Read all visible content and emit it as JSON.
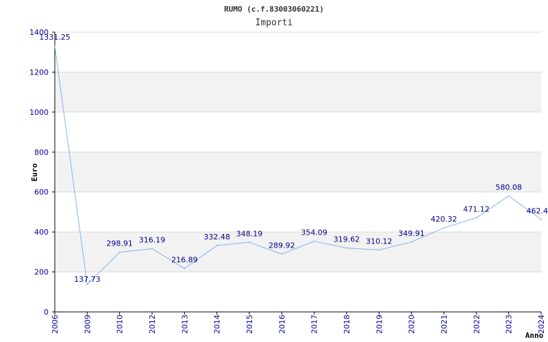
{
  "chart_data": {
    "type": "line",
    "title": "RUMO (c.f.83003060221)",
    "subtitle": "Importi",
    "xlabel": "Anno",
    "ylabel": "Euro",
    "categories": [
      "2006",
      "2009",
      "2010",
      "2012",
      "2013",
      "2014",
      "2015",
      "2016",
      "2017",
      "2018",
      "2019",
      "2020",
      "2021",
      "2022",
      "2023",
      "2024"
    ],
    "values": [
      1331.25,
      137.73,
      298.91,
      316.19,
      216.89,
      332.48,
      348.19,
      289.92,
      354.09,
      319.62,
      310.12,
      349.91,
      420.32,
      471.12,
      580.08,
      462.4
    ],
    "value_labels": [
      "1331.25",
      "137.73",
      "298.91",
      "316.19",
      "216.89",
      "332.48",
      "348.19",
      "289.92",
      "354.09",
      "319.62",
      "310.12",
      "349.91",
      "420.32",
      "471.12",
      "580.08",
      "462.4"
    ],
    "ylim": [
      0,
      1400
    ],
    "yticks": [
      "0",
      "200",
      "400",
      "600",
      "800",
      "1000",
      "1200",
      "1400"
    ],
    "grid": true,
    "legend": "none",
    "colors": {
      "line": "#7eb6f0",
      "band": "#f2f2f2",
      "gridline": "#dcdcdc",
      "axis": "#000000",
      "tick_label": "#0000a0",
      "data_label": "#00008b"
    }
  }
}
